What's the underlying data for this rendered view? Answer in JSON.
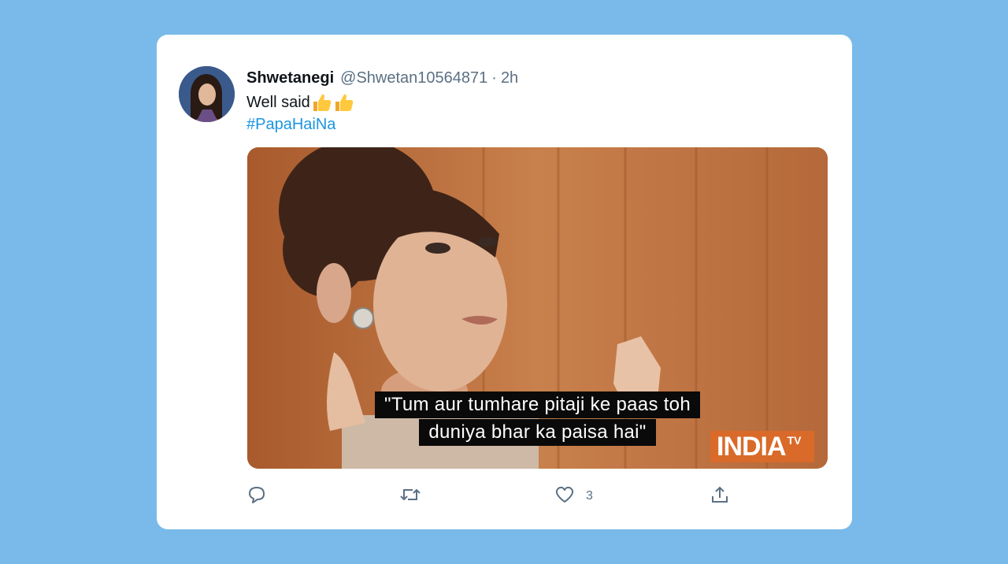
{
  "tweet": {
    "display_name": "Shwetanegi",
    "handle": "@Shwetan10564871",
    "separator": "·",
    "time": "2h",
    "text": "Well said",
    "emojis": [
      "thumbs-up-emoji",
      "thumbs-up-emoji"
    ],
    "hashtag": "#PapaHaiNa",
    "media": {
      "subtitle_line1": "\"Tum aur tumhare pitaji ke paas toh",
      "subtitle_line2": "duniya bhar ka paisa hai\"",
      "watermark_main": "INDIA",
      "watermark_sub": "TV"
    },
    "actions": {
      "reply_icon": "reply-icon",
      "retweet_icon": "retweet-icon",
      "like_icon": "heart-icon",
      "like_count": "3",
      "share_icon": "share-icon"
    }
  },
  "colors": {
    "background": "#79baea",
    "card": "#ffffff",
    "link": "#1b95e0",
    "secondary_text": "#5b7083"
  }
}
